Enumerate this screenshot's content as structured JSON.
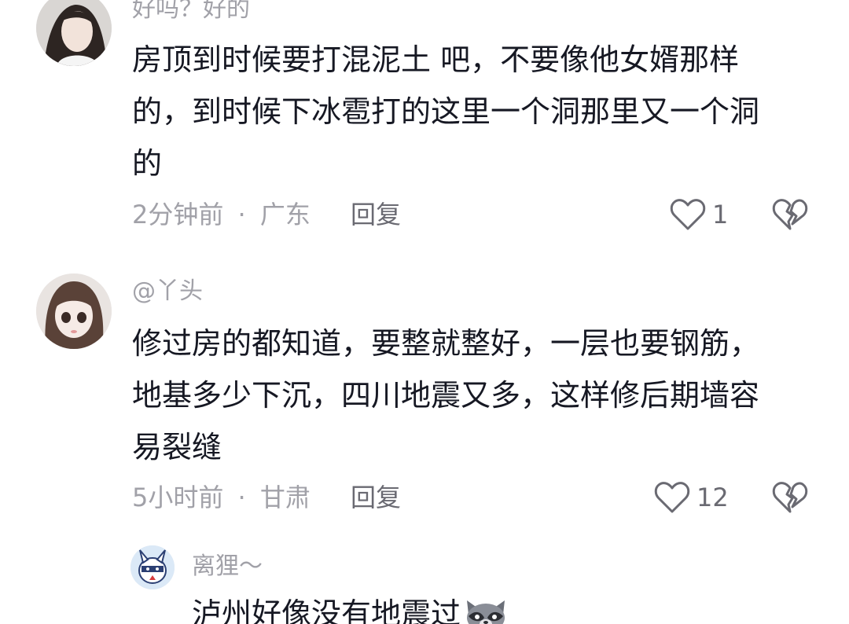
{
  "comments": [
    {
      "reply_prefix": "好吗？好的",
      "lines": [
        "房顶到时候要打混泥土 吧，不要像他女婿那样",
        "的，到时候下冰雹打的这里一个洞那里又一个洞",
        "的"
      ],
      "time": "2分钟前",
      "dot": "·",
      "location": "广东",
      "reply_label": "回复",
      "likes": "1"
    },
    {
      "username": "@丫头",
      "lines": [
        "修过房的都知道，要整就整好，一层也要钢筋，",
        "地基多少下沉，四川地震又多，这样修后期墙容",
        "易裂缝"
      ],
      "time": "5小时前",
      "dot": "·",
      "location": "甘肃",
      "reply_label": "回复",
      "likes": "12"
    },
    {
      "username": "离狸～",
      "lines": [
        "泸州好像没有地震过"
      ]
    }
  ],
  "icons": {
    "like": "heart-outline-icon",
    "dislike": "broken-heart-icon",
    "emoji": "raccoon-emoji-icon"
  },
  "colors": {
    "text": "#161823",
    "secondary": "#a1a1a8",
    "action": "#6a6a72"
  }
}
